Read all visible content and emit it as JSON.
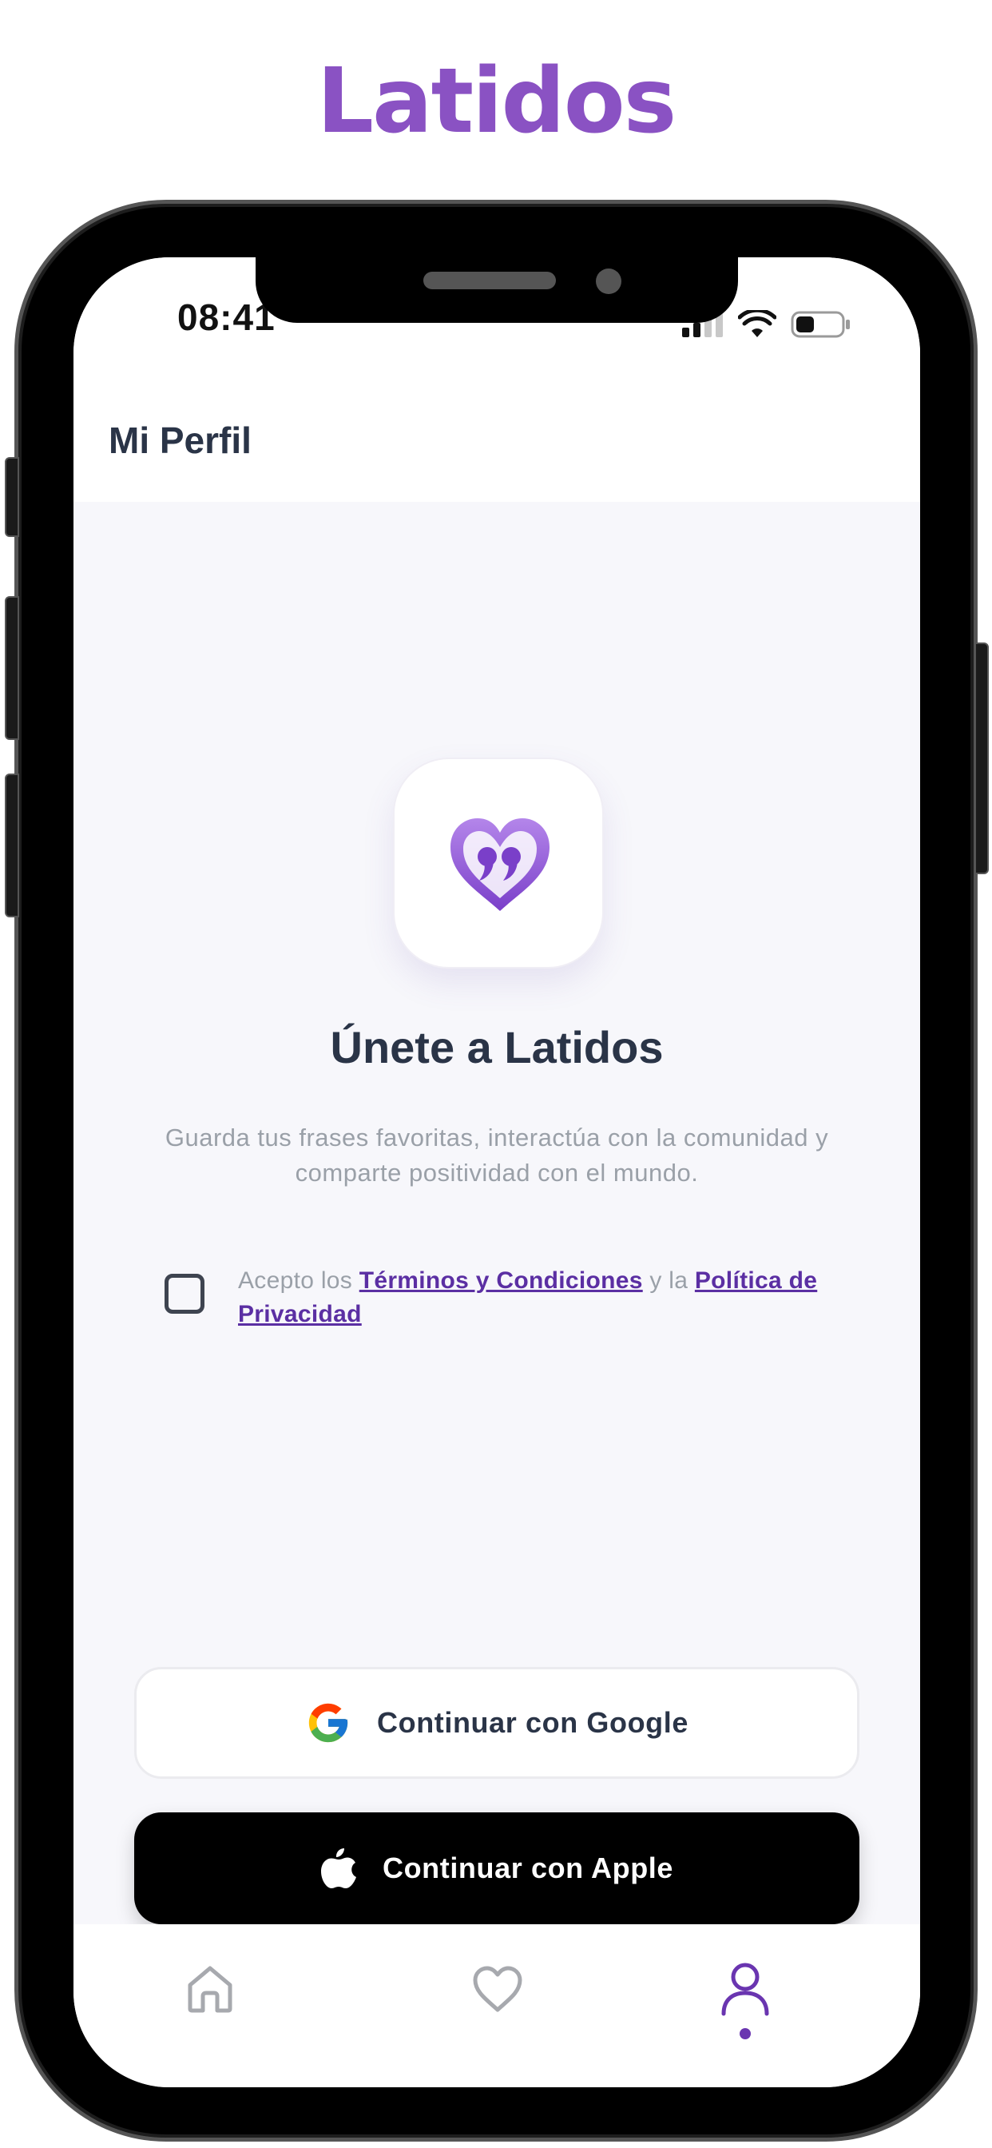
{
  "promo": {
    "title": "Latidos"
  },
  "status_bar": {
    "time": "08:41"
  },
  "header": {
    "title": "Mi Perfil"
  },
  "join": {
    "title": "Únete a Latidos",
    "subtitle": "Guarda tus frases favoritas, interactúa con la comunidad y comparte positividad con el mundo."
  },
  "terms": {
    "checked": false,
    "prefix": "Acepto los ",
    "terms_link": "Términos y Condiciones",
    "middle": " y la ",
    "privacy_link": "Política de Privacidad"
  },
  "buttons": {
    "google_label": "Continuar con Google",
    "apple_label": "Continuar con Apple"
  },
  "tabbar": {
    "items": [
      {
        "icon": "home-icon",
        "active": false
      },
      {
        "icon": "heart-icon",
        "active": false
      },
      {
        "icon": "user-icon",
        "active": true
      }
    ]
  },
  "colors": {
    "brand_purple": "#8a52c3",
    "link_purple": "#5b2fa3",
    "heading": "#2a3447",
    "muted_text": "#9aa0a8",
    "background": "#f7f7fb"
  }
}
